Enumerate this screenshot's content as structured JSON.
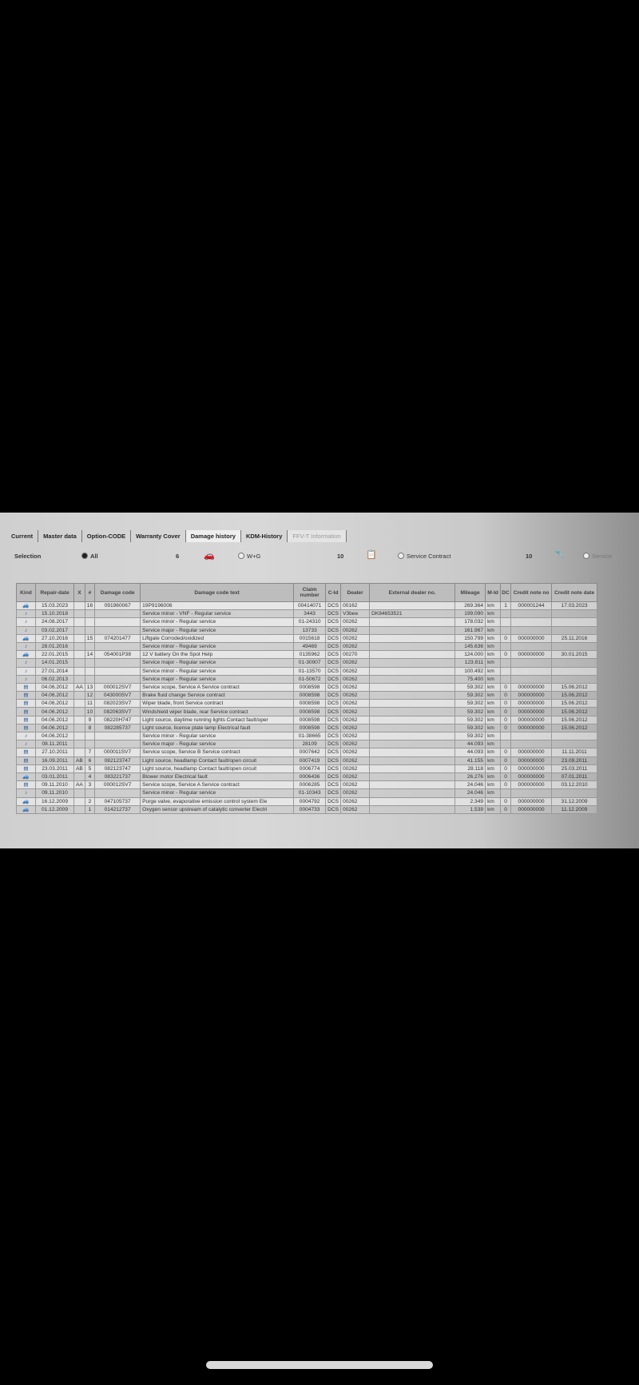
{
  "tabs": [
    {
      "label": "Current"
    },
    {
      "label": "Master data"
    },
    {
      "label": "Option-CODE"
    },
    {
      "label": "Warranty Cover"
    },
    {
      "label": "Damage history",
      "active": true
    },
    {
      "label": "KDM-History"
    },
    {
      "label": "FFV-T Information",
      "disabled": true
    }
  ],
  "selection": {
    "label": "Selection",
    "all": "All",
    "count1": "6",
    "wg": "W+G",
    "count2": "10",
    "service_contract": "Service Contract",
    "count3": "10",
    "service": "Service"
  },
  "icons": {
    "car": "car-icon",
    "service": "wrench-icon",
    "contract": "contract-icon"
  },
  "columns": [
    "Kind",
    "Repair-date",
    "X",
    "#",
    "Damage code",
    "Damage code text",
    "Claim number",
    "C-Id",
    "Dealer",
    "External dealer no.",
    "Mileage",
    "M-Id",
    "DC",
    "Credit note no",
    "Credit note date"
  ],
  "rows": [
    [
      "car",
      "15.03.2023",
      "",
      "16",
      "091960067",
      "19P9196006",
      "00414071",
      "DCS",
      "00162",
      "",
      "269.364",
      "km",
      "1",
      "000001244",
      "17.03.2023"
    ],
    [
      "service",
      "15.10.2018",
      "",
      "",
      "",
      "Service minor - VNF - Regular service",
      "3443",
      "DCS",
      "V3bee",
      "DK84653521",
      "199.090",
      "km",
      "",
      "",
      ""
    ],
    [
      "service",
      "24.08.2017",
      "",
      "",
      "",
      "Service minor - Regular service",
      "01-24310",
      "DCS",
      "00262",
      "",
      "178.032",
      "km",
      "",
      "",
      ""
    ],
    [
      "service",
      "03.02.2017",
      "",
      "",
      "",
      "Service major - Regular service",
      "13733",
      "DCS",
      "00262",
      "",
      "161.967",
      "km",
      "",
      "",
      ""
    ],
    [
      "car",
      "27.10.2016",
      "",
      "15",
      "074201477",
      "Liftgate Corroded/oxidized",
      "0015618",
      "DCS",
      "00262",
      "",
      "150.799",
      "km",
      "0",
      "000000000",
      "25.11.2016"
    ],
    [
      "service",
      "28.01.2016",
      "",
      "",
      "",
      "Service minor - Regular service",
      "49469",
      "DCS",
      "00262",
      "",
      "145.636",
      "km",
      "",
      "",
      ""
    ],
    [
      "car",
      "22.01.2015",
      "",
      "14",
      "054001P38",
      "12 V battery On the Spot Help",
      "0135962",
      "DCS",
      "00270",
      "",
      "124.000",
      "km",
      "0",
      "000000000",
      "30.01.2015"
    ],
    [
      "service",
      "14.01.2015",
      "",
      "",
      "",
      "Service major - Regular service",
      "01-30907",
      "DCS",
      "00262",
      "",
      "123.811",
      "km",
      "",
      "",
      ""
    ],
    [
      "service",
      "27.01.2014",
      "",
      "",
      "",
      "Service minor - Regular service",
      "01-13570",
      "DCS",
      "00262",
      "",
      "100.492",
      "km",
      "",
      "",
      ""
    ],
    [
      "service",
      "06.02.2013",
      "",
      "",
      "",
      "Service major - Regular service",
      "01-50672",
      "DCS",
      "00262",
      "",
      "75.400",
      "km",
      "",
      "",
      ""
    ],
    [
      "contract",
      "04.06.2012",
      "AA",
      "13",
      "000012SV7",
      "Service scope, Service A Service contract",
      "0008598",
      "DCS",
      "00262",
      "",
      "59.302",
      "km",
      "0",
      "000000000",
      "15.06.2012"
    ],
    [
      "contract",
      "04.06.2012",
      "",
      "12",
      "043000SV7",
      "Brake fluid change Service contract",
      "0008598",
      "DCS",
      "00262",
      "",
      "59.302",
      "km",
      "0",
      "000000000",
      "15.06.2012"
    ],
    [
      "contract",
      "04.06.2012",
      "",
      "11",
      "082023SV7",
      "Wiper blade, front Service contract",
      "0008598",
      "DCS",
      "00262",
      "",
      "59.302",
      "km",
      "0",
      "000000000",
      "15.06.2012"
    ],
    [
      "contract",
      "04.06.2012",
      "",
      "10",
      "082063SV7",
      "Windshield wiper blade, rear Service contract",
      "0008598",
      "DCS",
      "00262",
      "",
      "59.302",
      "km",
      "0",
      "000000000",
      "15.06.2012"
    ],
    [
      "contract",
      "04.06.2012",
      "",
      "9",
      "08220H747",
      "Light source, daytime running lights Contact fault/oper",
      "0008598",
      "DCS",
      "00262",
      "",
      "59.302",
      "km",
      "0",
      "000000000",
      "15.06.2012"
    ],
    [
      "contract",
      "04.06.2012",
      "",
      "8",
      "082285737",
      "Light source, license plate lamp Electrical fault",
      "0008598",
      "DCS",
      "00262",
      "",
      "59.302",
      "km",
      "0",
      "000000000",
      "15.06.2012"
    ],
    [
      "service",
      "04.06.2012",
      "",
      "",
      "",
      "Service minor - Regular service",
      "01-38665",
      "DCS",
      "00262",
      "",
      "59.302",
      "km",
      "",
      "",
      ""
    ],
    [
      "service",
      "08.11.2011",
      "",
      "",
      "",
      "Service major - Regular service",
      "28109",
      "DCS",
      "00262",
      "",
      "44.093",
      "km",
      "",
      "",
      ""
    ],
    [
      "contract",
      "27.10.2011",
      "",
      "7",
      "000011SV7",
      "Service scope, Service B Service contract",
      "0007642",
      "DCS",
      "00262",
      "",
      "44.093",
      "km",
      "0",
      "000000000",
      "11.11.2011"
    ],
    [
      "contract",
      "16.09.2011",
      "AB",
      "6",
      "082123747",
      "Light source, headlamp Contact fault/open circuit",
      "0007419",
      "DCS",
      "00262",
      "",
      "41.155",
      "km",
      "0",
      "000000000",
      "23.09.2011"
    ],
    [
      "contract",
      "23.03.2011",
      "AB",
      "5",
      "082123747",
      "Light source, headlamp Contact fault/open circuit",
      "0006774",
      "DCS",
      "00262",
      "",
      "28.118",
      "km",
      "0",
      "000000000",
      "25.03.2011"
    ],
    [
      "car",
      "03.01.2011",
      "",
      "4",
      "083221737",
      "Blower motor Electrical fault",
      "0006436",
      "DCS",
      "00262",
      "",
      "26.276",
      "km",
      "0",
      "000000000",
      "07.01.2011"
    ],
    [
      "contract",
      "09.11.2010",
      "AA",
      "3",
      "000012SV7",
      "Service scope, Service A Service contract",
      "0006285",
      "DCS",
      "00262",
      "",
      "24.046",
      "km",
      "0",
      "000000000",
      "03.12.2010"
    ],
    [
      "service",
      "09.11.2010",
      "",
      "",
      "",
      "Service minor - Regular service",
      "01-10343",
      "DCS",
      "00262",
      "",
      "24.046",
      "km",
      "",
      "",
      ""
    ],
    [
      "car",
      "16.12.2009",
      "",
      "2",
      "047105737",
      "Purge valve, evaporative emission control system Ele",
      "0004792",
      "DCS",
      "00262",
      "",
      "2.349",
      "km",
      "0",
      "000000000",
      "31.12.2009"
    ],
    [
      "car",
      "01.12.2009",
      "",
      "1",
      "014212737",
      "Oxygen sensor upstream of catalytic converter Electri",
      "0004733",
      "DCS",
      "00262",
      "",
      "1.539",
      "km",
      "0",
      "000000000",
      "11.12.2009"
    ]
  ]
}
